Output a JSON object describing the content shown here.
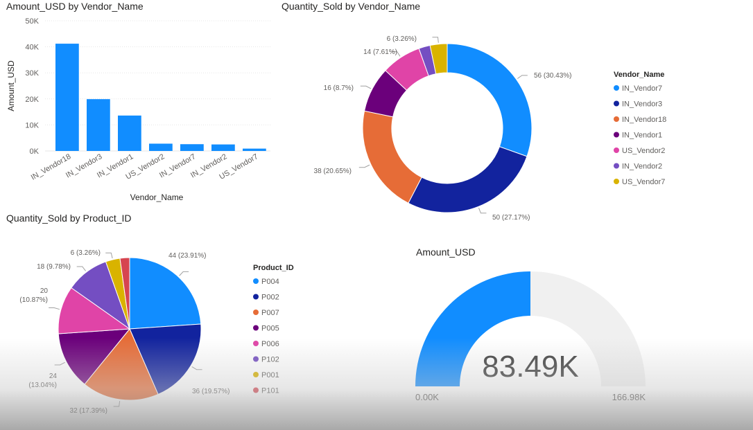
{
  "colors": {
    "text": "#252423",
    "axis": "#605E5C",
    "grid": "#E6E6E6",
    "bar": "#118DFF",
    "gauge_track": "#F0F0F0",
    "gauge_fill": "#118DFF"
  },
  "bar_chart": {
    "title": "Amount_USD by Vendor_Name",
    "xlabel": "Vendor_Name",
    "ylabel": "Amount_USD",
    "yticks": [
      "0K",
      "10K",
      "20K",
      "30K",
      "40K",
      "50K"
    ]
  },
  "donut_chart": {
    "title": "Quantity_Sold by Vendor_Name",
    "legend_title": "Vendor_Name"
  },
  "pie_chart": {
    "title": "Quantity_Sold by Product_ID",
    "legend_title": "Product_ID"
  },
  "gauge": {
    "title": "Amount_USD",
    "value_label": "83.49K",
    "min_label": "0.00K",
    "max_label": "166.98K"
  },
  "chart_data": [
    {
      "type": "bar",
      "title": "Amount_USD by Vendor_Name",
      "xlabel": "Vendor_Name",
      "ylabel": "Amount_USD",
      "categories": [
        "IN_Vendor18",
        "IN_Vendor3",
        "IN_Vendor1",
        "US_Vendor2",
        "IN_Vendor7",
        "IN_Vendor2",
        "US_Vendor7"
      ],
      "values": [
        41200,
        19900,
        13600,
        2800,
        2600,
        2500,
        900
      ],
      "ylim": [
        0,
        50000
      ],
      "color": "#118DFF"
    },
    {
      "type": "pie",
      "title": "Quantity_Sold by Vendor_Name",
      "donut": true,
      "legend_title": "Vendor_Name",
      "legend_position": "right",
      "slices": [
        {
          "name": "IN_Vendor7",
          "value": 56,
          "label": "56 (30.43%)",
          "color": "#118DFF"
        },
        {
          "name": "IN_Vendor3",
          "value": 50,
          "label": "50 (27.17%)",
          "color": "#12239E"
        },
        {
          "name": "IN_Vendor18",
          "value": 38,
          "label": "38 (20.65%)",
          "color": "#E66C37"
        },
        {
          "name": "IN_Vendor1",
          "value": 16,
          "label": "16 (8.7%)",
          "color": "#6B007B"
        },
        {
          "name": "US_Vendor2",
          "value": 14,
          "label": "14 (7.61%)",
          "color": "#E044A7"
        },
        {
          "name": "IN_Vendor2",
          "value": 4,
          "label": "",
          "color": "#744EC2"
        },
        {
          "name": "US_Vendor7",
          "value": 6,
          "label": "6 (3.26%)",
          "color": "#D9B300"
        }
      ]
    },
    {
      "type": "pie",
      "title": "Quantity_Sold by Product_ID",
      "donut": false,
      "legend_title": "Product_ID",
      "legend_position": "right",
      "slices": [
        {
          "name": "P004",
          "value": 44,
          "label": "44 (23.91%)",
          "color": "#118DFF"
        },
        {
          "name": "P002",
          "value": 36,
          "label": "36 (19.57%)",
          "color": "#12239E"
        },
        {
          "name": "P007",
          "value": 32,
          "label": "32 (17.39%)",
          "color": "#E66C37"
        },
        {
          "name": "P005",
          "value": 24,
          "label": "24 (13.04%)",
          "color": "#6B007B"
        },
        {
          "name": "P006",
          "value": 20,
          "label": "20 (10.87%)",
          "color": "#E044A7"
        },
        {
          "name": "P102",
          "value": 18,
          "label": "18 (9.78%)",
          "color": "#744EC2"
        },
        {
          "name": "P001",
          "value": 6,
          "label": "6 (3.26%)",
          "color": "#D9B300"
        },
        {
          "name": "P101",
          "value": 4,
          "label": "",
          "color": "#D64550"
        }
      ]
    },
    {
      "type": "gauge",
      "title": "Amount_USD",
      "value": 83490,
      "min": 0,
      "max": 166980,
      "value_label": "83.49K",
      "min_label": "0.00K",
      "max_label": "166.98K"
    }
  ]
}
